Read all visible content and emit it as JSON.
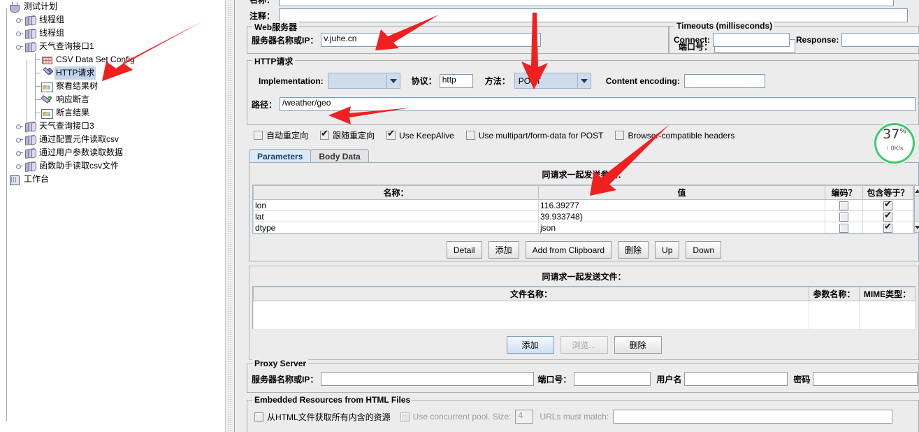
{
  "tree": {
    "nodes": [
      {
        "label": "测试计划",
        "icon": "flask-icon",
        "depth": 0,
        "selected": false
      },
      {
        "label": "线程组",
        "icon": "thread-group-icon",
        "depth": 1,
        "selected": false
      },
      {
        "label": "线程组",
        "icon": "thread-group-icon",
        "depth": 1,
        "selected": false
      },
      {
        "label": "天气查询接口1",
        "icon": "thread-group-icon",
        "depth": 1,
        "selected": false
      },
      {
        "label": "CSV Data Set Config",
        "icon": "csv-data-set-icon",
        "depth": 2,
        "selected": false
      },
      {
        "label": "HTTP请求",
        "icon": "http-request-icon",
        "depth": 2,
        "selected": true
      },
      {
        "label": "察看结果树",
        "icon": "view-results-tree-icon",
        "depth": 2,
        "selected": false
      },
      {
        "label": "响应断言",
        "icon": "response-assertion-icon",
        "depth": 2,
        "selected": false
      },
      {
        "label": "断言结果",
        "icon": "assertion-results-icon",
        "depth": 2,
        "selected": false
      },
      {
        "label": "天气查询接口3",
        "icon": "thread-group-icon",
        "depth": 1,
        "selected": false
      },
      {
        "label": "通过配置元件读取csv",
        "icon": "thread-group-icon",
        "depth": 1,
        "selected": false
      },
      {
        "label": "通过用户参数读取数据",
        "icon": "thread-group-icon",
        "depth": 1,
        "selected": false
      },
      {
        "label": "函数助手读取csv文件",
        "icon": "thread-group-icon",
        "depth": 1,
        "selected": false
      },
      {
        "label": "工作台",
        "icon": "workbench-icon",
        "depth": 0,
        "selected": false
      }
    ]
  },
  "form": {
    "comments_label": "注释：",
    "comments_value": "",
    "web_server": {
      "title": "Web服务器",
      "server_label": "服务器名称或IP：",
      "server_value": "v.juhe.cn",
      "port_label": "端口号：",
      "port_value": ""
    },
    "timeouts": {
      "title": "Timeouts (milliseconds)",
      "connect_label": "Connect:",
      "connect_value": "",
      "response_label": "Response:",
      "response_value": ""
    },
    "http_request": {
      "title": "HTTP请求",
      "implementation_label": "Implementation:",
      "implementation_value": "",
      "protocol_label": "协议：",
      "protocol_value": "http",
      "method_label": "方法：",
      "method_value": "POST",
      "content_encoding_label": "Content encoding:",
      "content_encoding_value": "",
      "path_label": "路径：",
      "path_value": "/weather/geo"
    },
    "options": [
      {
        "label": "自动重定向",
        "checked": false,
        "disabled": false
      },
      {
        "label": "跟随重定向",
        "checked": true,
        "disabled": false
      },
      {
        "label": "Use KeepAlive",
        "checked": true,
        "disabled": false
      },
      {
        "label": "Use multipart/form-data for POST",
        "checked": false,
        "disabled": false
      },
      {
        "label": "Browser-compatible headers",
        "checked": false,
        "disabled": false
      }
    ],
    "tabs": [
      {
        "label": "Parameters",
        "active": true
      },
      {
        "label": "Body Data",
        "active": false
      }
    ],
    "params_table": {
      "caption": "同请求一起发送参数：",
      "headers": [
        "名称：",
        "值",
        "编码？",
        "包含等于？"
      ],
      "rows": [
        {
          "name": "lon",
          "value": "116.39277",
          "encode": false,
          "include_equals": true
        },
        {
          "name": "lat",
          "value": "39.933748}",
          "encode": false,
          "include_equals": true
        },
        {
          "name": "dtype",
          "value": "json",
          "encode": false,
          "include_equals": true
        }
      ]
    },
    "params_buttons": [
      "Detail",
      "添加",
      "Add from Clipboard",
      "删除",
      "Up",
      "Down"
    ],
    "files_table": {
      "caption": "同请求一起发送文件：",
      "headers": [
        "文件名称：",
        "参数名称：",
        "MIME类型："
      ],
      "rows": []
    },
    "files_buttons": [
      {
        "label": "添加",
        "primary": true,
        "disabled": false
      },
      {
        "label": "浏览...",
        "primary": false,
        "disabled": true
      },
      {
        "label": "删除",
        "primary": false,
        "disabled": false
      }
    ],
    "proxy": {
      "title": "Proxy Server",
      "server_label": "服务器名称或IP：",
      "server_value": "",
      "port_label": "端口号：",
      "port_value": "",
      "username_label": "用户名",
      "username_value": "",
      "password_label": "密码",
      "password_value": ""
    },
    "embedded": {
      "title": "Embedded Resources from HTML Files",
      "retrieve_label": "从HTML文件获取所有内含的资源",
      "retrieve_checked": false,
      "pool_label": "Use concurrent pool. Size:",
      "pool_checked": false,
      "pool_size": "4",
      "urls_label": "URLs must match:",
      "urls_value": ""
    }
  },
  "speed_widget": {
    "percent": "37",
    "percent_unit": "%",
    "rate": "0K/s",
    "ring_color": "#3ec96b"
  },
  "annotation_color": "#f02020"
}
